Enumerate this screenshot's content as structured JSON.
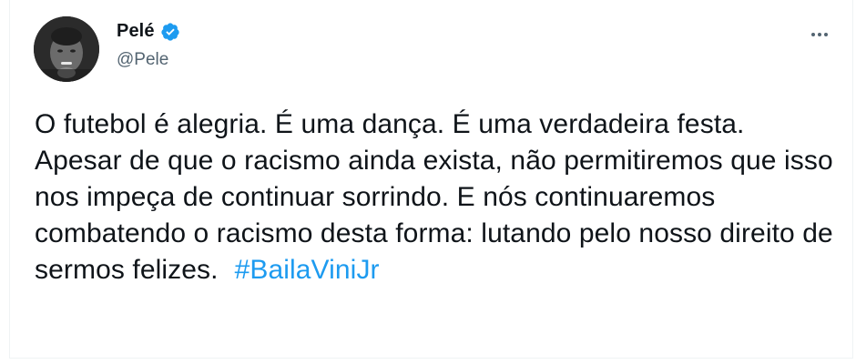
{
  "tweet": {
    "author": {
      "display_name": "Pelé",
      "handle": "@Pele",
      "verified": true,
      "avatar_icon": "profile-photo"
    },
    "more_icon": "more-horizontal-icon",
    "text": "O futebol é alegria. É uma dança. É uma verdadeira festa. Apesar de que o racismo ainda exista, não permitiremos que isso nos impeça de continuar sorrindo. E nós continuaremos combatendo o racismo desta forma: lutando pelo nosso direito de sermos felizes.",
    "hashtag": "#BailaViniJr"
  },
  "colors": {
    "accent": "#1d9bf0",
    "text": "#0f1419",
    "secondary": "#536471",
    "border": "#eff3f4"
  }
}
